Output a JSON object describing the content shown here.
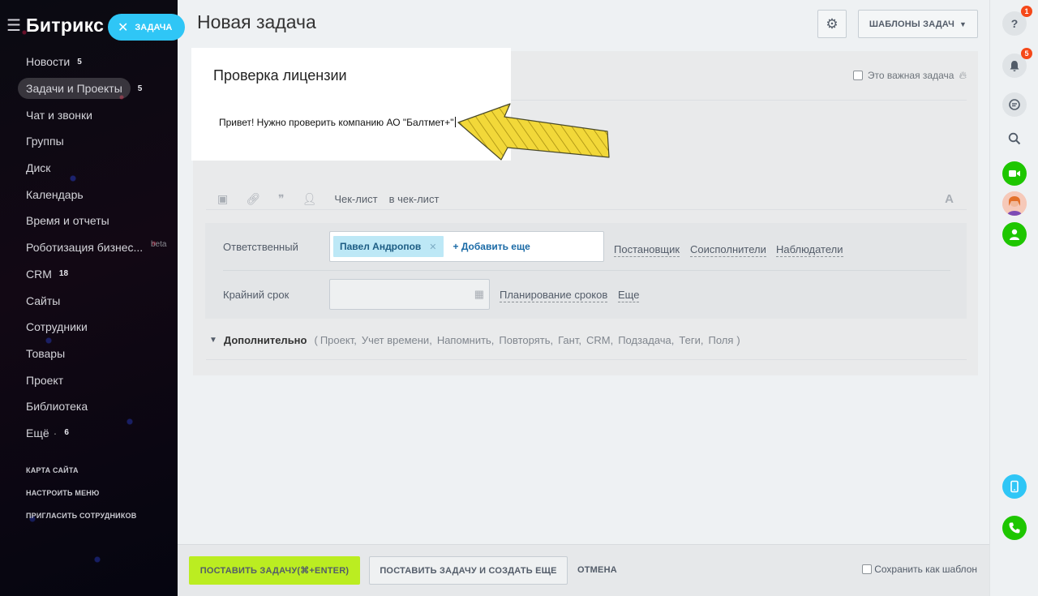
{
  "sidebar": {
    "logo": "Битрикс 2",
    "task_button": "ЗАДАЧА",
    "items": [
      {
        "label": "Новости",
        "count": "5"
      },
      {
        "label": "Задачи и Проекты",
        "count": "5"
      },
      {
        "label": "Чат и звонки",
        "count": ""
      },
      {
        "label": "Группы",
        "count": ""
      },
      {
        "label": "Диск",
        "count": ""
      },
      {
        "label": "Календарь",
        "count": ""
      },
      {
        "label": "Время и отчеты",
        "count": ""
      },
      {
        "label": "Роботизация бизнес...",
        "count": "",
        "badge": "beta"
      },
      {
        "label": "CRM",
        "count": "18"
      },
      {
        "label": "Сайты",
        "count": ""
      },
      {
        "label": "Сотрудники",
        "count": ""
      },
      {
        "label": "Товары",
        "count": ""
      },
      {
        "label": "Проект",
        "count": ""
      },
      {
        "label": "Библиотека",
        "count": ""
      },
      {
        "label": "Ещё",
        "count": "6"
      }
    ],
    "footer": {
      "site_map": "КАРТА САЙТА",
      "configure_menu": "НАСТРОИТЬ МЕНЮ",
      "invite": "ПРИГЛАСИТЬ СОТРУДНИКОВ"
    }
  },
  "header": {
    "title": "Новая задача",
    "templates_button": "ШАБЛОНЫ ЗАДАЧ"
  },
  "task": {
    "title": "Проверка лицензии",
    "description": "Привет! Нужно проверить компанию АО \"Балтмет+\"",
    "important_label": "Это важная задача"
  },
  "toolbar": {
    "checklist": "Чек-лист",
    "to_checklist": "в чек-лист"
  },
  "fields": {
    "responsible_label": "Ответственный",
    "responsible_user": "Павел Андропов",
    "add_more": "+ Добавить еще",
    "creator": "Постановщик",
    "coexecutors": "Соисполнители",
    "observers": "Наблюдатели",
    "deadline_label": "Крайний срок",
    "planning": "Планирование сроков",
    "more": "Еще"
  },
  "additional": {
    "label": "Дополнительно",
    "open_paren": "(",
    "items": [
      "Проект,",
      "Учет времени,",
      "Напомнить,",
      "Повторять,",
      "Гант,",
      "CRM,",
      "Подзадача,",
      "Теги,",
      "Поля"
    ],
    "close_paren": ")"
  },
  "footer": {
    "submit": "ПОСТАВИТЬ ЗАДАЧУ(⌘+ENTER)",
    "submit_and_create": "ПОСТАВИТЬ ЗАДАЧУ И СОЗДАТЬ ЕЩЕ",
    "cancel": "ОТМЕНА",
    "save_as_template": "Сохранить как шаблон"
  },
  "rightbar": {
    "help_badge": "1",
    "notifications_badge": "5",
    "help_glyph": "?"
  },
  "colors": {
    "accent_blue": "#2fc6f6",
    "submit_green": "#bbed21",
    "badge_red": "#f54819",
    "arrow_yellow": "#f2d839"
  }
}
